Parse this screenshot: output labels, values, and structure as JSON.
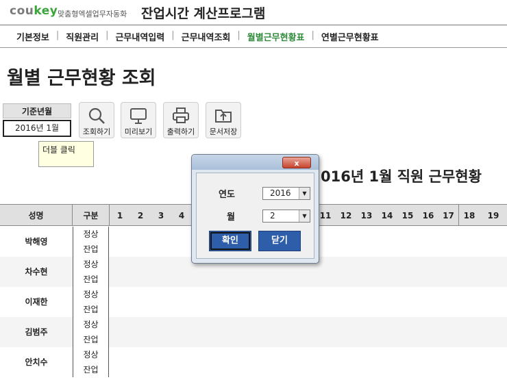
{
  "header": {
    "logo_a": "cou",
    "logo_b": "key",
    "tagline": "맞춤형엑셀업무자동화",
    "app_title": "잔업시간 계산프로그램"
  },
  "nav": [
    "기본정보",
    "직원관리",
    "근무내역입력",
    "근무내역조회",
    "월별근무현황표",
    "연별근무현황표"
  ],
  "nav_active": 4,
  "page_title": "월별 근무현황 조회",
  "base": {
    "label": "기준년월",
    "value": "2016년 1월",
    "tooltip": "더블 클릭"
  },
  "toolbar": [
    {
      "label": "조회하기",
      "icon": "search-icon"
    },
    {
      "label": "미리보기",
      "icon": "monitor-icon"
    },
    {
      "label": "출력하기",
      "icon": "printer-icon"
    },
    {
      "label": "문서저장",
      "icon": "folder-upload-icon"
    }
  ],
  "report_title": "016년 1월 직원 근무현황",
  "table": {
    "headers": [
      "성명",
      "구분"
    ],
    "days_left": [
      "1",
      "2",
      "3",
      "4"
    ],
    "days_right": [
      "11",
      "12",
      "13",
      "14",
      "15",
      "16",
      "17",
      "18",
      "19"
    ],
    "rows": [
      {
        "name": "박해영",
        "kinds": [
          "정상",
          "잔업"
        ]
      },
      {
        "name": "차수현",
        "kinds": [
          "정상",
          "잔업"
        ]
      },
      {
        "name": "이재한",
        "kinds": [
          "정상",
          "잔업"
        ]
      },
      {
        "name": "김범주",
        "kinds": [
          "정상",
          "잔업"
        ]
      },
      {
        "name": "안치수",
        "kinds": [
          "정상",
          "잔업"
        ]
      }
    ]
  },
  "dialog": {
    "close_label": "x",
    "year_label": "연도",
    "year_value": "2016",
    "month_label": "월",
    "month_value": "2",
    "ok_label": "확인",
    "close_button_label": "닫기"
  }
}
